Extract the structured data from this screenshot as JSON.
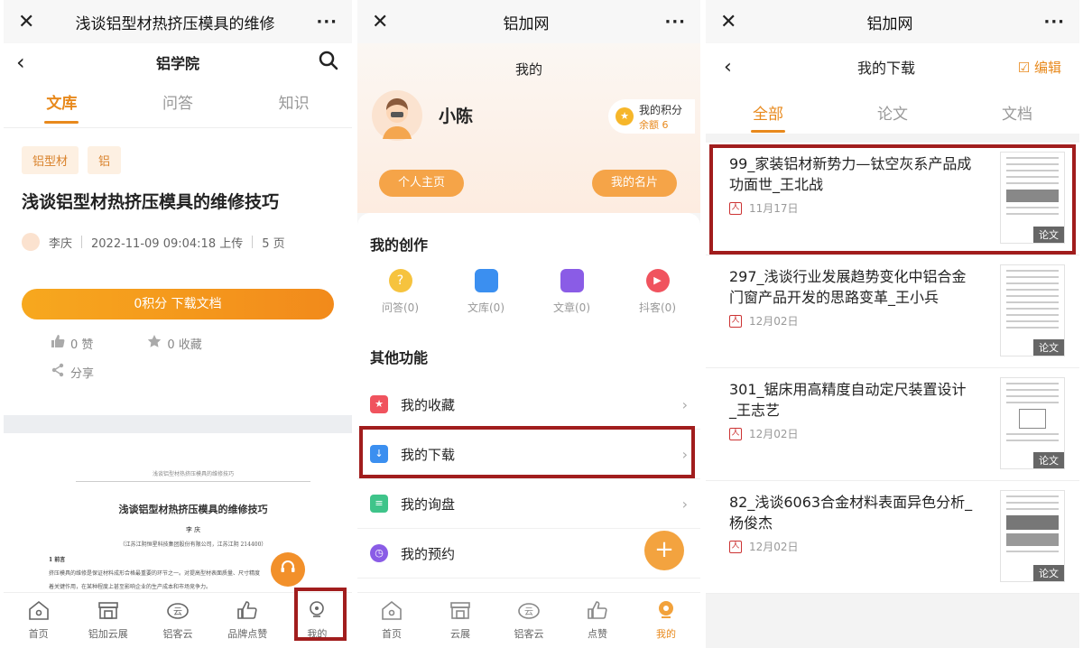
{
  "panel1": {
    "top_title": "浅谈铝型材热挤压模具的维修",
    "nav_title": "铝学院",
    "tabs": [
      "文库",
      "问答",
      "知识"
    ],
    "tags": [
      "铝型材",
      "铝"
    ],
    "doc_title": "浅谈铝型材热挤压模具的维修技巧",
    "author": "李庆",
    "uploaded": "2022-11-09 09:04:18 上传",
    "pages": "5 页",
    "download_label": "0积分  下载文档",
    "likes": "0 赞",
    "favorites": "0 收藏",
    "share": "分享",
    "preview": {
      "header": "浅谈铝型材热挤压模具的维修技巧",
      "title": "浅谈铝型材热挤压模具的维修技巧",
      "author": "李  庆",
      "affiliation": "（江苏江阴恒星科技集团股份有限公司，江苏江阴 214400）",
      "section": "1  前言",
      "line1": "挤压模具的维修是保证材料成形合格最重要的环节之一。对提高型材表面质量、尺寸精度",
      "line2": "着关键作用，在某种程度上甚至影响企业的生产成本和市场竞争力。"
    },
    "bottom_nav": [
      "首页",
      "铝加云展",
      "铝客云",
      "品牌点赞",
      "我的"
    ]
  },
  "panel2": {
    "top_title": "铝加网",
    "sub_title": "我的",
    "user_name": "小陈",
    "points_label": "我的积分",
    "points_balance": "余额 6",
    "btn_home": "个人主页",
    "btn_card": "我的名片",
    "creation_title": "我的创作",
    "creation_items": [
      "问答(0)",
      "文库(0)",
      "文章(0)",
      "抖客(0)"
    ],
    "other_title": "其他功能",
    "menu_items": [
      "我的收藏",
      "我的下载",
      "我的询盘",
      "我的预约"
    ],
    "bottom_nav": [
      "首页",
      "云展",
      "铝客云",
      "点赞",
      "我的"
    ]
  },
  "panel3": {
    "top_title": "铝加网",
    "nav_title": "我的下载",
    "edit_label": "编辑",
    "tabs": [
      "全部",
      "论文",
      "文档"
    ],
    "downloads": [
      {
        "title": "99_家装铝材新势力—钛空灰系产品成功面世_王北战",
        "date": "11月17日",
        "badge": "论文"
      },
      {
        "title": "297_浅谈行业发展趋势变化中铝合金门窗产品开发的思路变革_王小兵",
        "date": "12月02日",
        "badge": "论文"
      },
      {
        "title": "301_锯床用高精度自动定尺装置设计_王志艺",
        "date": "12月02日",
        "badge": "论文"
      },
      {
        "title": "82_浅谈6063合金材料表面异色分析_杨俊杰",
        "date": "12月02日",
        "badge": "论文"
      }
    ]
  },
  "colors": {
    "accent": "#e8891c",
    "highlight_box": "#a11d1d"
  }
}
